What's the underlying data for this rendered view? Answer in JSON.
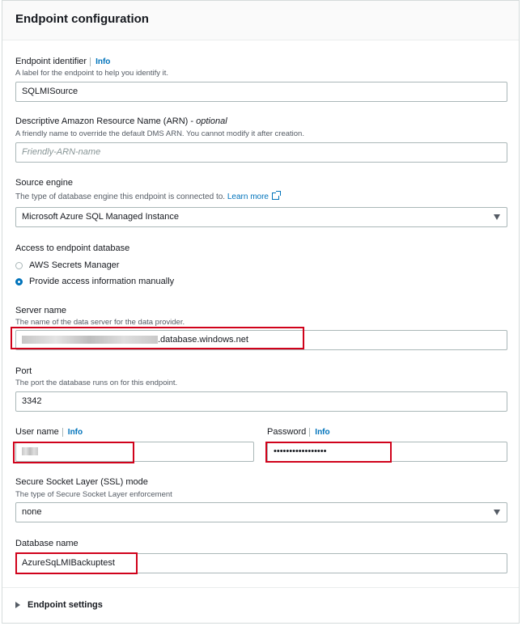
{
  "panel": {
    "title": "Endpoint configuration"
  },
  "endpoint_identifier": {
    "label": "Endpoint identifier",
    "info": "Info",
    "description": "A label for the endpoint to help you identify it.",
    "value": "SQLMISource"
  },
  "arn": {
    "label": "Descriptive Amazon Resource Name (ARN) - ",
    "optional": "optional",
    "description": "A friendly name to override the default DMS ARN. You cannot modify it after creation.",
    "placeholder": "Friendly-ARN-name"
  },
  "source_engine": {
    "label": "Source engine",
    "description": "The type of database engine this endpoint is connected to.",
    "learn_more": "Learn more",
    "value": "Microsoft Azure SQL Managed Instance"
  },
  "access": {
    "label": "Access to endpoint database",
    "options": [
      {
        "label": "AWS Secrets Manager",
        "checked": false
      },
      {
        "label": "Provide access information manually",
        "checked": true
      }
    ]
  },
  "server_name": {
    "label": "Server name",
    "description": "The name of the data server for the data provider.",
    "value_suffix": ".database.windows.net"
  },
  "port": {
    "label": "Port",
    "description": "The port the database runs on for this endpoint.",
    "value": "3342"
  },
  "user_name": {
    "label": "User name",
    "info": "Info"
  },
  "password": {
    "label": "Password",
    "info": "Info",
    "value": "•••••••••••••••••"
  },
  "ssl_mode": {
    "label": "Secure Socket Layer (SSL) mode",
    "description": "The type of Secure Socket Layer enforcement",
    "value": "none"
  },
  "database_name": {
    "label": "Database name",
    "value": "AzureSqLMIBackuptest"
  },
  "endpoint_settings": {
    "label": "Endpoint settings"
  },
  "colors": {
    "accent": "#0073bb",
    "highlight": "#d0021b"
  }
}
